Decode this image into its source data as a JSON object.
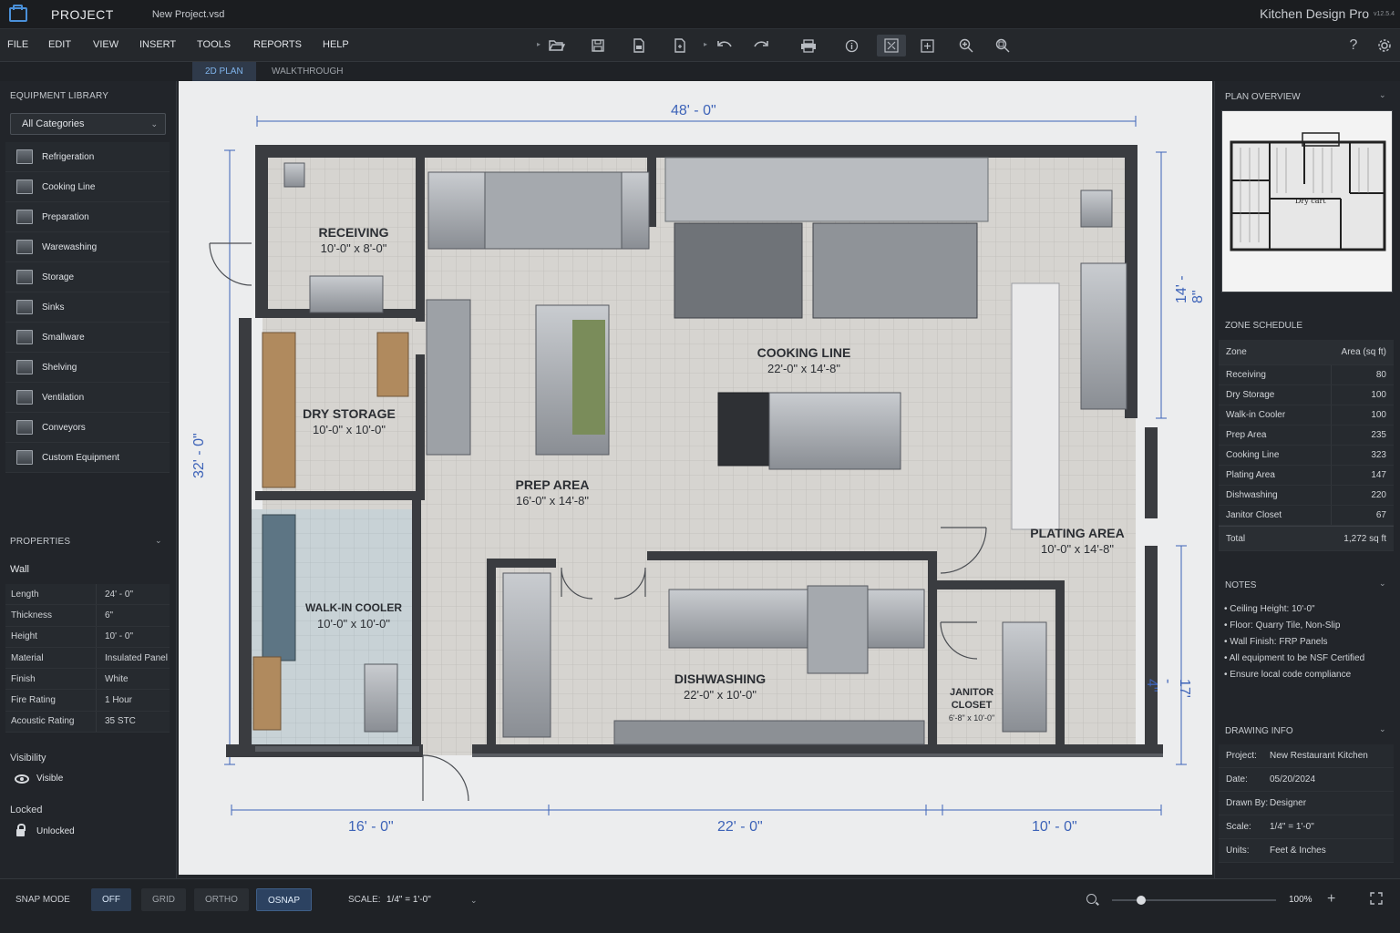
{
  "titlebar": {
    "project_label": "PROJECT",
    "file_name": "New Project.vsd",
    "app_title": "Kitchen Design Pro",
    "version": "v12.5.4"
  },
  "menu": [
    "FILE",
    "EDIT",
    "VIEW",
    "INSERT",
    "TOOLS",
    "REPORTS",
    "HELP"
  ],
  "toolbar": {
    "icons": [
      "open-icon",
      "save-icon",
      "export-icon",
      "new-doc-icon",
      "undo-icon",
      "redo-icon",
      "print-icon",
      "info-icon",
      "grid-view-icon",
      "fit-page-icon",
      "zoom-in-icon",
      "zoom-extents-icon"
    ],
    "help_label": "?"
  },
  "view_tabs": [
    "2D PLAN",
    "WALKTHROUGH"
  ],
  "equipment_library": {
    "header": "EQUIPMENT LIBRARY",
    "category_selected": "All Categories",
    "items": [
      "Refrigeration",
      "Cooking Line",
      "Preparation",
      "Warewashing",
      "Storage",
      "Sinks",
      "Smallware",
      "Shelving",
      "Ventilation",
      "Conveyors",
      "Custom Equipment"
    ]
  },
  "properties": {
    "header": "PROPERTIES",
    "object": "Wall",
    "rows": [
      {
        "k": "Length",
        "v": "24' - 0\""
      },
      {
        "k": "Thickness",
        "v": "6\""
      },
      {
        "k": "Height",
        "v": "10' - 0\""
      },
      {
        "k": "Material",
        "v": "Insulated Panel"
      },
      {
        "k": "Finish",
        "v": "White"
      },
      {
        "k": "Fire Rating",
        "v": "1 Hour"
      },
      {
        "k": "Acoustic Rating",
        "v": "35 STC"
      }
    ],
    "visibility_label": "Visibility",
    "visibility_value": "Visible",
    "locked_label": "Locked",
    "locked_value": "Unlocked"
  },
  "plan": {
    "dim_top": "48' - 0\"",
    "dim_left": "32' - 0\"",
    "dim_right_top": "14' - 8\"",
    "dim_right_bottom": "17' - 4\"",
    "dim_bottom": [
      "16' - 0\"",
      "22' - 0\"",
      "10' - 0\""
    ],
    "zones": [
      {
        "name": "RECEIVING",
        "size": "10'-0\" x 8'-0\""
      },
      {
        "name": "DRY STORAGE",
        "size": "10'-0\" x 10'-0\""
      },
      {
        "name": "WALK-IN COOLER",
        "size": "10'-0\" x 10'-0\""
      },
      {
        "name": "PREP AREA",
        "size": "16'-0\" x 14'-8\""
      },
      {
        "name": "COOKING LINE",
        "size": "22'-0\" x 14'-8\""
      },
      {
        "name": "PLATING AREA",
        "size": "10'-0\" x 14'-8\""
      },
      {
        "name": "DISHWASHING",
        "size": "22'-0\" x 10'-0\""
      },
      {
        "name": "JANITOR CLOSET",
        "size": "6'-8\" x 10'-0\""
      }
    ]
  },
  "plan_overview": {
    "header": "PLAN OVERVIEW",
    "thumb_label": "Dry cart"
  },
  "zone_schedule": {
    "header": "ZONE SCHEDULE",
    "col_zone": "Zone",
    "col_area": "Area (sq ft)",
    "rows": [
      {
        "zone": "Receiving",
        "area": "80"
      },
      {
        "zone": "Dry Storage",
        "area": "100"
      },
      {
        "zone": "Walk-in Cooler",
        "area": "100"
      },
      {
        "zone": "Prep Area",
        "area": "235"
      },
      {
        "zone": "Cooking Line",
        "area": "323"
      },
      {
        "zone": "Plating Area",
        "area": "147"
      },
      {
        "zone": "Dishwashing",
        "area": "220"
      },
      {
        "zone": "Janitor Closet",
        "area": "67"
      }
    ],
    "total_label": "Total",
    "total_value": "1,272 sq ft"
  },
  "notes": {
    "header": "NOTES",
    "items": [
      "• Ceiling Height: 10'-0\"",
      "• Floor: Quarry Tile, Non-Slip",
      "• Wall Finish: FRP Panels",
      "• All equipment to be NSF Certified",
      "• Ensure local code compliance"
    ]
  },
  "drawing_info": {
    "header": "DRAWING INFO",
    "rows": [
      {
        "k": "Project:",
        "v": "New Restaurant Kitchen"
      },
      {
        "k": "Date:",
        "v": "05/20/2024"
      },
      {
        "k": "Drawn By:",
        "v": "Designer"
      },
      {
        "k": "Scale:",
        "v": "1/4\" = 1'-0\""
      },
      {
        "k": "Units:",
        "v": "Feet & Inches"
      }
    ]
  },
  "statusbar": {
    "snap_label": "SNAP MODE",
    "snap_buttons": [
      "OFF",
      "GRID",
      "ORTHO",
      "OSNAP"
    ],
    "scale_label": "SCALE:",
    "scale_value": "1/4\" = 1'-0\"",
    "zoom_value": "100%",
    "zoom_fraction": 0.18
  },
  "colors": {
    "accent": "#4a90d9",
    "dimension_blue": "#3d63b8",
    "wall": "#3a3c40",
    "floor": "#d9d7d3"
  }
}
